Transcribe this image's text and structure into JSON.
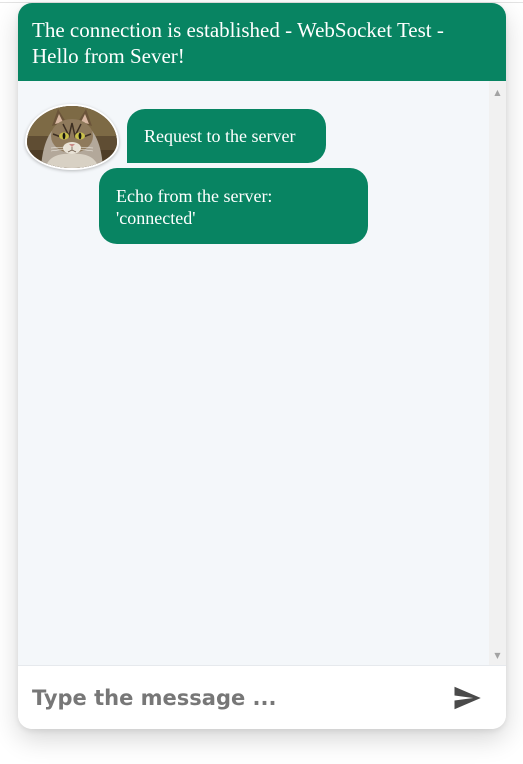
{
  "header": {
    "line1": "The connection is established - WebSocket Test -",
    "line2": "Hello from Sever!"
  },
  "messages": [
    {
      "text": "Request to the server",
      "sender": "user"
    },
    {
      "text_line1": "Echo from the server:",
      "text_line2": "'connected'",
      "sender": "server"
    }
  ],
  "composer": {
    "placeholder": "Type the message ...",
    "send_icon": "paper-plane-send-icon"
  },
  "colors": {
    "accent": "#088462",
    "chat_background": "#f4f7fa",
    "bubble_text": "#ffffff"
  }
}
